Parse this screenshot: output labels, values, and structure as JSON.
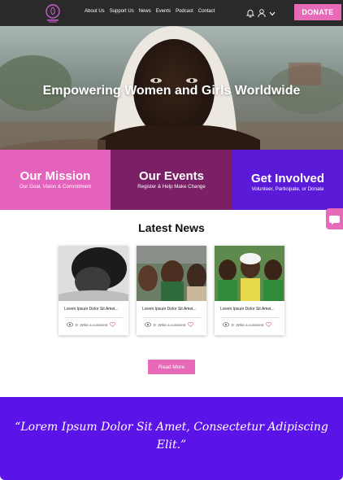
{
  "nav": {
    "logo": "brand-logo",
    "links": [
      "About Us",
      "Support Us",
      "News",
      "Events",
      "Podcast",
      "Contact"
    ],
    "donate": "DONATE"
  },
  "hero": {
    "title": "Empowering Women and Girls Worldwide"
  },
  "features": [
    {
      "title": "Our Mission",
      "subtitle": "Our Goal, Vision & Commitment",
      "color": "#e462bb"
    },
    {
      "title": "Our Events",
      "subtitle": "Register & Help Make Change",
      "color": "#7b1f66"
    },
    {
      "title": "Get Involved",
      "subtitle": "Volunteer, Participate, or Donate",
      "color": "#5a1ad8"
    }
  ],
  "news": {
    "heading": "Latest News",
    "cards": [
      {
        "title": "Lorem Ipsum Dolor Sit Amet...",
        "count": "0",
        "comment": "Write a comment"
      },
      {
        "title": "Lorem Ipsum Dolor Sit Amet...",
        "count": "0",
        "comment": "Write a comment"
      },
      {
        "title": "Lorem Ipsum Dolor Sit Amet...",
        "count": "0",
        "comment": "Write a comment"
      }
    ],
    "read_more": "Read More"
  },
  "quote": {
    "text": "“Lorem Ipsum Dolor Sit Amet, Consectetur Adipiscing Elit.”"
  },
  "colors": {
    "accent_pink": "#e66ab8",
    "dark_magenta": "#7b1f66",
    "violet": "#5b14e8",
    "nav_dark": "#2a2a2a"
  }
}
